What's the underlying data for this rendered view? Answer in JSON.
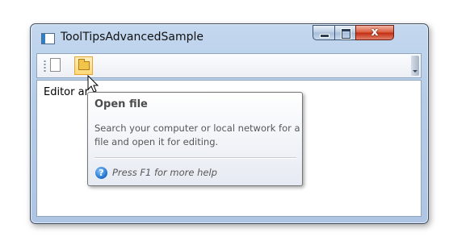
{
  "window": {
    "title": "ToolTipsAdvancedSample",
    "close_glyph": "x"
  },
  "editor": {
    "text": "Editor ar"
  },
  "tooltip": {
    "title": "Open file",
    "body": "Search your computer or local network for a file and open it for editing.",
    "help_icon_glyph": "?",
    "help_text": "Press F1 for more help"
  },
  "icons": {
    "app": "app-window-icon",
    "new": "new-document-icon",
    "open": "open-folder-icon",
    "help": "help-icon",
    "cursor": "mouse-pointer-icon"
  },
  "colors": {
    "window_frame": "#aec6e4",
    "close_button": "#c22c10",
    "open_button_highlight": "#ffd97a",
    "help_icon": "#1a6dc9"
  }
}
